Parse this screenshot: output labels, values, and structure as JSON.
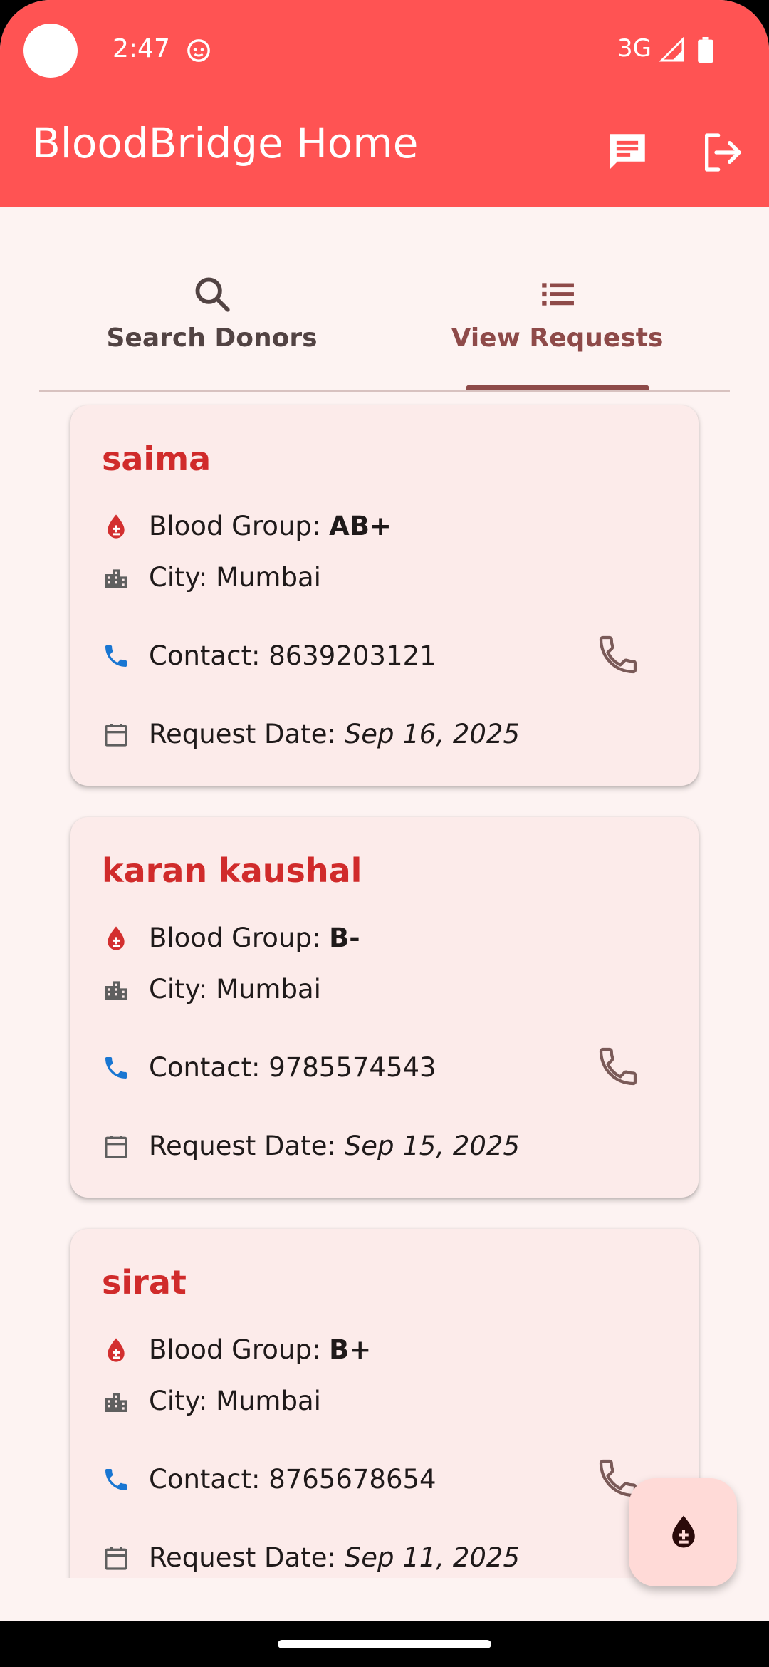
{
  "status_bar": {
    "time": "2:47",
    "network": "3G"
  },
  "app_bar": {
    "title": "BloodBridge Home"
  },
  "tabs": [
    {
      "label": "Search Donors",
      "icon": "search-icon",
      "selected": false
    },
    {
      "label": "View Requests",
      "icon": "list-icon",
      "selected": true
    }
  ],
  "labels": {
    "blood_group": "Blood Group: ",
    "city": "City: ",
    "contact": "Contact: ",
    "request_date": "Request Date: "
  },
  "requests": [
    {
      "name": "saima",
      "blood_group": "AB+",
      "city": "Mumbai",
      "contact": "8639203121",
      "date": "Sep 16, 2025"
    },
    {
      "name": "karan kaushal",
      "blood_group": "B-",
      "city": "Mumbai",
      "contact": "9785574543",
      "date": "Sep 15, 2025"
    },
    {
      "name": "sirat",
      "blood_group": "B+",
      "city": "Mumbai",
      "contact": "8765678654",
      "date": "Sep 11, 2025"
    }
  ],
  "colors": {
    "app_bar": "#ff5353",
    "background": "#fdf3f2",
    "card": "#fcebea",
    "name": "#d02b2b",
    "tab_selected": "#8e4a49",
    "contact_icon": "#1976d2",
    "fab": "#ffdad7"
  }
}
